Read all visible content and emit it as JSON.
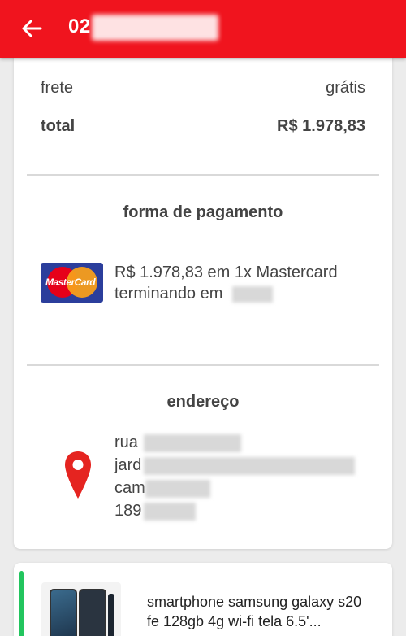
{
  "header": {
    "order_prefix": "02"
  },
  "summary": {
    "shipping_label": "frete",
    "shipping_value": "grátis",
    "total_label": "total",
    "total_value": "R$ 1.978,83"
  },
  "payment": {
    "title": "forma de pagamento",
    "card_brand_logo_text": "MasterCard",
    "line1": "R$ 1.978,83 em 1x Mastercard",
    "line2": "terminando em"
  },
  "address": {
    "title": "endereço",
    "line1": "rua",
    "line2": "jard",
    "line3": "cam",
    "line4": "189"
  },
  "product": {
    "title": "smartphone samsung galaxy s20 fe 128gb 4g wi-fi tela 6.5'..."
  },
  "colors": {
    "brand_red": "#f0141e",
    "status_green": "#22c55e"
  }
}
